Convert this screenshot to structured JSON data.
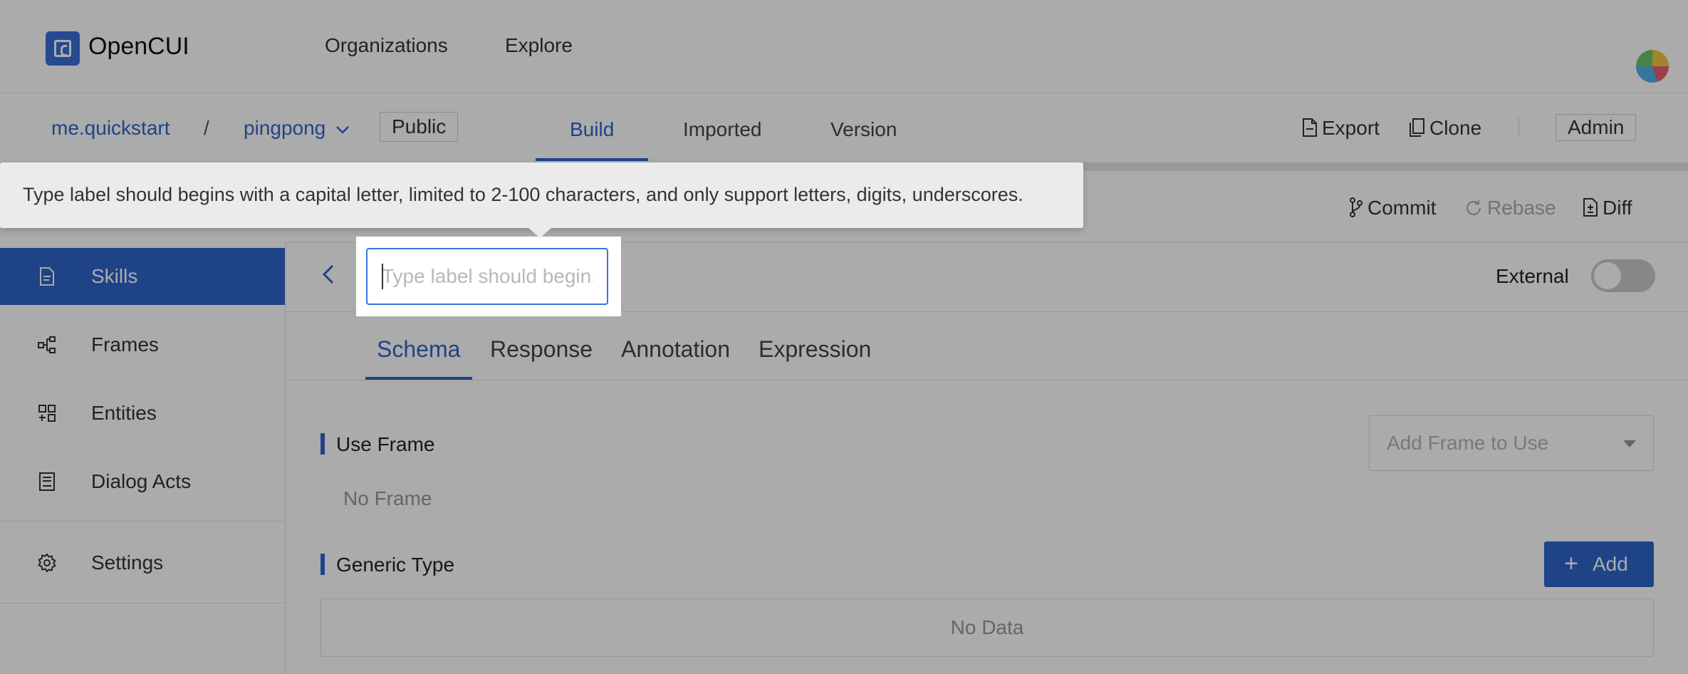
{
  "app": {
    "brand": "OpenCUI"
  },
  "top_nav": {
    "organizations": "Organizations",
    "explore": "Explore"
  },
  "project": {
    "org": "me.quickstart",
    "separator": "/",
    "name": "pingpong",
    "visibility": "Public",
    "tabs": [
      "Build",
      "Imported",
      "Version"
    ],
    "active_tab": "Build",
    "actions": {
      "export": "Export",
      "clone": "Clone",
      "admin": "Admin"
    }
  },
  "subbar": {
    "commit": "Commit",
    "rebase": "Rebase",
    "diff": "Diff"
  },
  "sidebar": {
    "items": [
      {
        "label": "Skills",
        "icon": "document-icon",
        "active": true
      },
      {
        "label": "Frames",
        "icon": "frames-icon"
      },
      {
        "label": "Entities",
        "icon": "entities-icon"
      },
      {
        "label": "Dialog Acts",
        "icon": "dialog-acts-icon"
      },
      {
        "label": "Settings",
        "icon": "gear-icon"
      }
    ]
  },
  "editor": {
    "back_icon": "chevron-left-icon",
    "label_input": {
      "value": "",
      "placeholder": "Type label should begins with a capital letter"
    },
    "external_label": "External",
    "external_enabled": false,
    "tabs": [
      "Schema",
      "Response",
      "Annotation",
      "Expression"
    ],
    "active_tab": "Schema",
    "use_frame": {
      "title": "Use Frame",
      "empty": "No Frame",
      "select_placeholder": "Add Frame to Use"
    },
    "generic_type": {
      "title": "Generic Type",
      "add_label": "Add",
      "empty": "No Data"
    }
  },
  "tooltip": {
    "text": "Type label should begins with a capital letter, limited to 2-100 characters, and only support letters, digits, underscores."
  },
  "colors": {
    "accent": "#2f64c9",
    "overlay": "rgba(0,0,0,0.33)"
  }
}
